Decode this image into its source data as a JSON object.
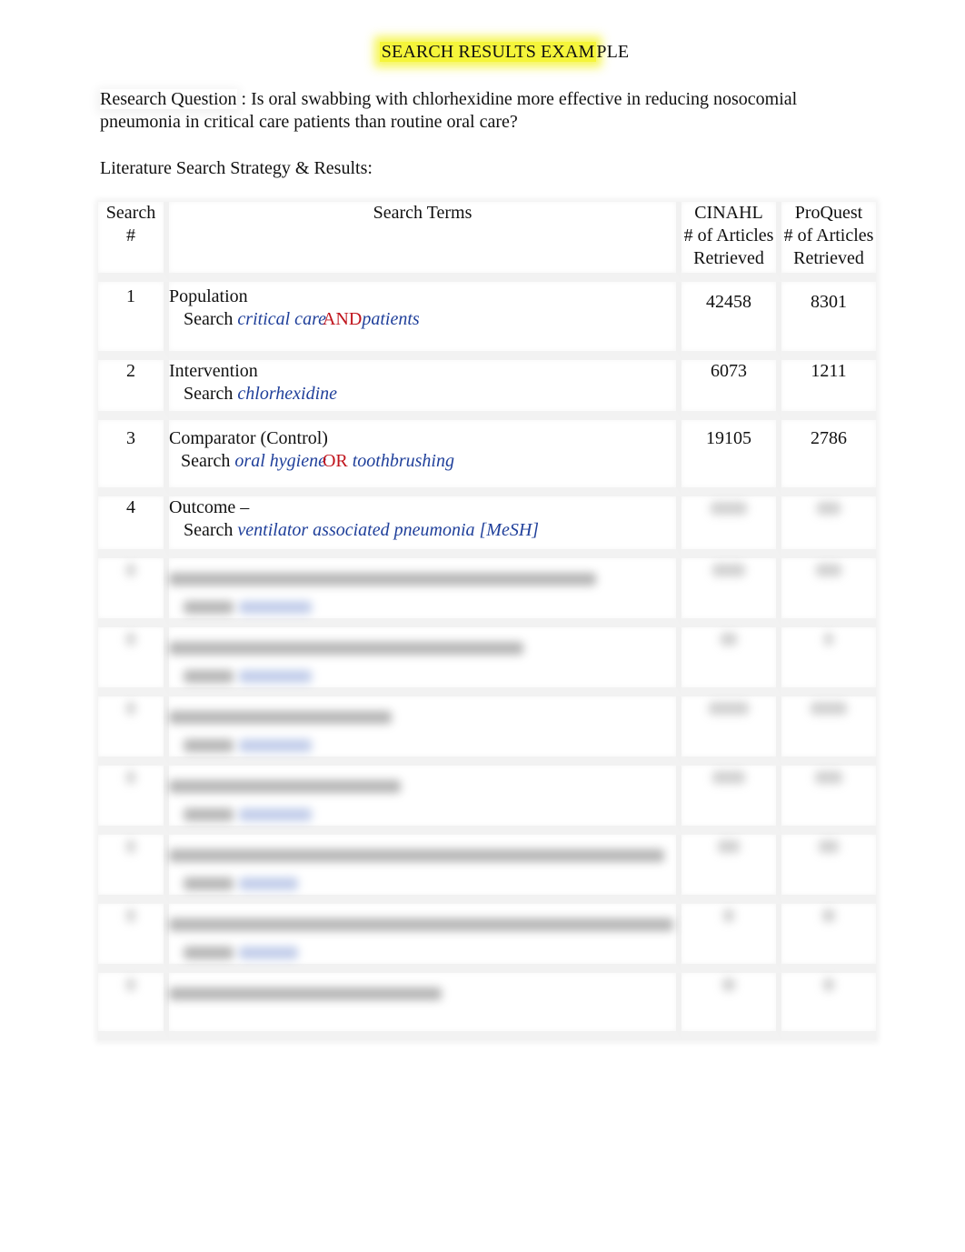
{
  "document": {
    "title_highlighted": "SEARCH RESULTS EXAM",
    "title_rest": "PLE",
    "research_question_label": "Research Question",
    "research_question_sep": " : ",
    "research_question_text": "Is oral swabbing with chlorhexidine more effective in reducing nosocomial pneumonia in critical care patients than routine oral care?",
    "section_heading": "Literature Search Strategy & Results:"
  },
  "table": {
    "headers": {
      "search_num_line1": "Search",
      "search_num_line2": "#",
      "search_terms": "Search Terms",
      "cinahl_line1": "CINAHL",
      "cinahl_line2": "# of Articles",
      "cinahl_line3": "Retrieved",
      "proquest_line1": "ProQuest",
      "proquest_line2": "# of Articles",
      "proquest_line3": "Retrieved"
    },
    "rows": [
      {
        "num": "1",
        "category": "Population",
        "search_label": "Search",
        "term1": "critical care",
        "operator": "AND",
        "term2": "patients",
        "cinahl": "42458",
        "proquest": "8301"
      },
      {
        "num": "2",
        "category": "Intervention",
        "search_label": "Search",
        "term1": "chlorhexidine",
        "cinahl": "6073",
        "proquest": "1211"
      },
      {
        "num": "3",
        "category": "Comparator (Control)",
        "search_label": "Search",
        "term1": "oral hygiene",
        "operator": "OR",
        "term2": "toothbrushing",
        "cinahl": "19105",
        "proquest": "2786"
      },
      {
        "num": "4",
        "category": "Outcome –",
        "search_label": "Search",
        "term1": "ventilator associated pneumonia [MeSH]"
      }
    ],
    "blurred_row_count": 7
  },
  "colors": {
    "highlight": "#f5f53a",
    "search_term": "#1f3f9a",
    "operator": "#c0141c"
  }
}
